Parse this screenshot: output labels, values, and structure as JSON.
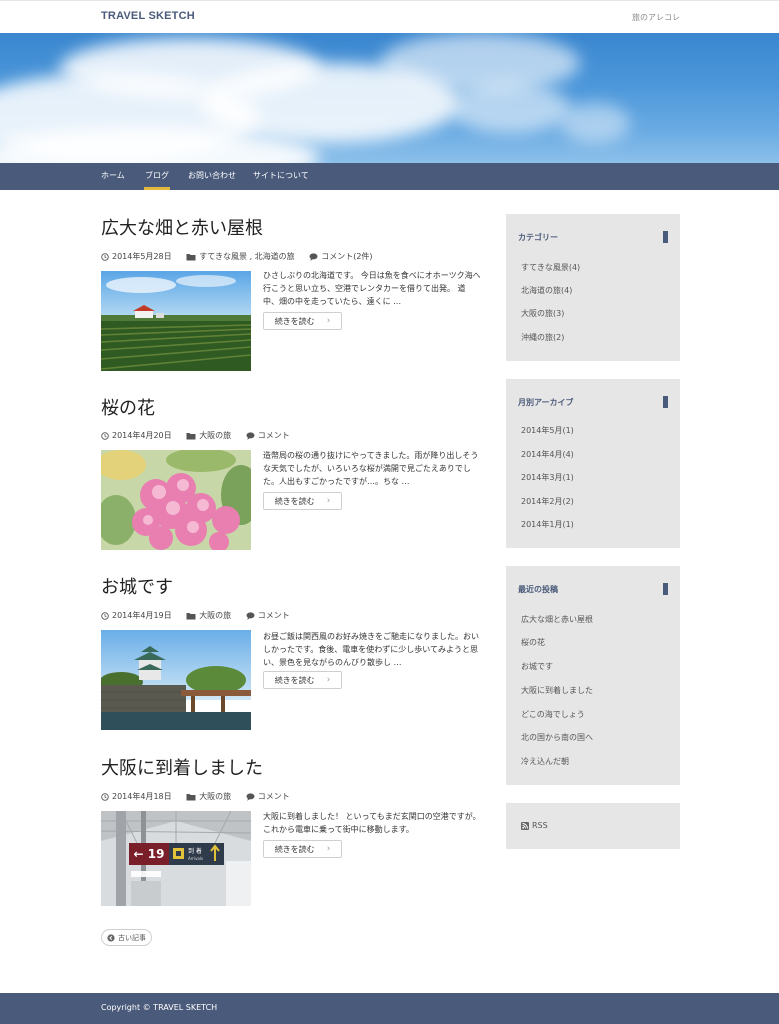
{
  "site": {
    "logo": "TRAVEL SKETCH",
    "tagline": "旅のアレコレ"
  },
  "nav": {
    "items": [
      {
        "label": "ホーム",
        "active": false
      },
      {
        "label": "ブログ",
        "active": true
      },
      {
        "label": "お問い合わせ",
        "active": false
      },
      {
        "label": "サイトについて",
        "active": false
      }
    ]
  },
  "posts": [
    {
      "title": "広大な畑と赤い屋根",
      "date": "2014年5月28日",
      "categories": "すてきな風景 , 北海道の旅",
      "comments": "コメント(2件)",
      "excerpt": "ひさしぶりの北海道です。 今日は魚を食べにオホーツク海へ行こうと思い立ち、空港でレンタカーを借りて出発。 道中、畑の中を走っていたら、遠くに …",
      "more": "続きを読む",
      "thumb": "farm"
    },
    {
      "title": "桜の花",
      "date": "2014年4月20日",
      "categories": "大阪の旅",
      "comments": "コメント",
      "excerpt": "造幣局の桜の通り抜けにやってきました。雨が降り出しそうな天気でしたが、いろいろな桜が満開で見ごたえありでした。人出もすごかったですが…。ちな …",
      "more": "続きを読む",
      "thumb": "sakura"
    },
    {
      "title": "お城です",
      "date": "2014年4月19日",
      "categories": "大阪の旅",
      "comments": "コメント",
      "excerpt": "お昼ご飯は関西風のお好み焼きをご馳走になりました。おいしかったです。食後、電車を使わずに少し歩いてみようと思い、景色を見ながらのんびり散歩し …",
      "more": "続きを読む",
      "thumb": "castle"
    },
    {
      "title": "大阪に到着しました",
      "date": "2014年4月18日",
      "categories": "大阪の旅",
      "comments": "コメント",
      "excerpt": "大阪に到着しました！ といってもまだ玄関口の空港ですが。これから電車に乗って街中に移動します。",
      "more": "続きを読む",
      "thumb": "airport",
      "sign": {
        "gate": "← 19",
        "arrivals_jp": "到 着",
        "arrivals_en": "Arrivals"
      }
    }
  ],
  "pagination": {
    "older": "古い記事"
  },
  "sidebar": {
    "categories": {
      "title": "カテゴリー",
      "items": [
        "すてきな風景(4)",
        "北海道の旅(4)",
        "大阪の旅(3)",
        "沖縄の旅(2)"
      ]
    },
    "archives": {
      "title": "月別アーカイブ",
      "items": [
        "2014年5月(1)",
        "2014年4月(4)",
        "2014年3月(1)",
        "2014年2月(2)",
        "2014年1月(1)"
      ]
    },
    "recent": {
      "title": "最近の投稿",
      "items": [
        "広大な畑と赤い屋根",
        "桜の花",
        "お城です",
        "大阪に到着しました",
        "どこの海でしょう",
        "北の国から南の国へ",
        "冷え込んだ朝"
      ]
    },
    "rss": {
      "label": "RSS"
    }
  },
  "footer": {
    "copyright": "Copyright © TRAVEL SKETCH"
  },
  "colors": {
    "brand": "#4a5a7a",
    "nav_active": "#e2b93b",
    "widget_bg": "#e6e6e6"
  }
}
